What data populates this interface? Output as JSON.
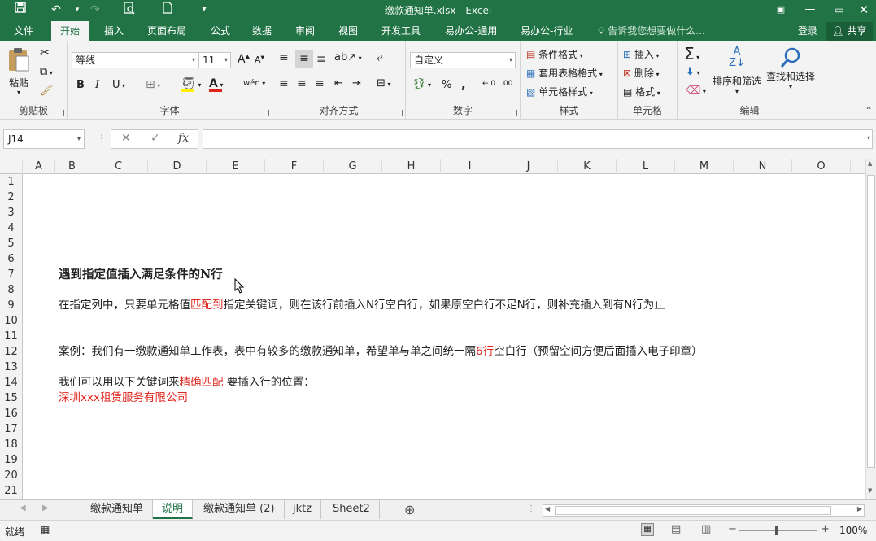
{
  "titlebar": {
    "title": "缴款通知单.xlsx - Excel",
    "quick_access": [
      "save-icon",
      "undo-icon",
      "redo-icon",
      "print-preview-icon",
      "new-file-icon",
      "customize-icon"
    ]
  },
  "tabs": [
    "文件",
    "开始",
    "插入",
    "页面布局",
    "公式",
    "数据",
    "审阅",
    "视图",
    "开发工具",
    "易办公-通用",
    "易办公-行业"
  ],
  "active_tab": "开始",
  "tell_me": "告诉我您想要做什么...",
  "login": "登录",
  "share": "共享",
  "ribbon": {
    "clipboard": {
      "label": "剪贴板",
      "paste": "粘贴"
    },
    "font": {
      "label": "字体",
      "name": "等线",
      "size": "11",
      "bold": "B",
      "italic": "I",
      "underline": "U",
      "grow": "A",
      "shrink": "A",
      "phonetic": "wén"
    },
    "alignment": {
      "label": "对齐方式"
    },
    "number": {
      "label": "数字",
      "format": "自定义",
      "percent": "%",
      "comma": ","
    },
    "styles": {
      "label": "样式",
      "conditional": "条件格式",
      "table": "套用表格格式",
      "cell_styles": "单元格样式"
    },
    "cells": {
      "label": "单元格",
      "insert": "插入",
      "delete": "删除",
      "format": "格式"
    },
    "editing": {
      "label": "编辑",
      "sort": "排序和筛选",
      "find": "查找和选择"
    }
  },
  "formula_bar": {
    "name_box": "J14",
    "cancel": "✕",
    "enter": "✓",
    "fx": "fx",
    "formula": ""
  },
  "columns": [
    "A",
    "B",
    "C",
    "D",
    "E",
    "F",
    "G",
    "H",
    "I",
    "J",
    "K",
    "L",
    "M",
    "N",
    "O"
  ],
  "rows": [
    "1",
    "2",
    "3",
    "4",
    "5",
    "6",
    "7",
    "8",
    "9",
    "10",
    "11",
    "12",
    "13",
    "14",
    "15",
    "16",
    "17",
    "18",
    "19",
    "20",
    "21"
  ],
  "cells": {
    "r7": "遇到指定值插入满足条件的N行",
    "r9_a": "在指定列中，只要单元格值",
    "r9_red": "匹配到",
    "r9_b": "指定关键词，则在该行前插入N行空白行，如果原空白行不足N行，则补充插入到有N行为止",
    "r12_a": "案例：我们有一缴款通知单工作表，表中有较多的缴款通知单，希望单与单之间统一隔",
    "r12_red": "6行",
    "r12_b": "空白行（预留空间方便后面插入电子印章）",
    "r14_a": "我们可以用以下关键词来",
    "r14_red": "精确匹配",
    "r14_b": " 要插入行的位置：",
    "r15": "深圳xxx租赁服务有限公司"
  },
  "sheets": [
    "缴款通知单",
    "说明",
    "缴款通知单 (2)",
    "jktz",
    "Sheet2"
  ],
  "active_sheet": "说明",
  "status": {
    "ready": "就绪",
    "zoom": "100%"
  },
  "colors": {
    "accent": "#217346",
    "highlight_text": "#e0241b"
  }
}
